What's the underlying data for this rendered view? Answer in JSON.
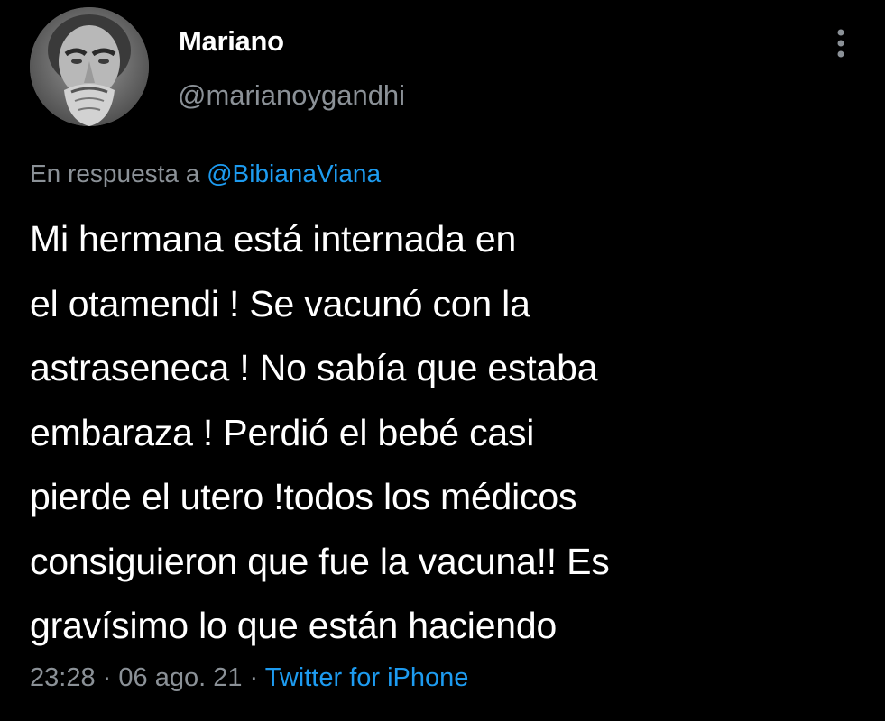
{
  "tweet": {
    "author": {
      "display_name": "Mariano",
      "handle": "@marianoygandhi"
    },
    "reply_to": {
      "prefix": "En respuesta a",
      "mention": "@BibianaViana"
    },
    "text": "Mi hermana está internada en\nel otamendi ! Se vacunó con la\nastraseneca ! No sabía que estaba\nembaraza ! Perdió el bebé casi\npierde el utero !todos los médicos\nconsiguieron que fue la vacuna!! Es\ngravísimo lo que están haciendo",
    "time": "23:28",
    "date": "06 ago. 21",
    "source": "Twitter for iPhone",
    "separator": "·"
  },
  "icons": {
    "more": "more-vertical-icon",
    "avatar": "statue-avatar"
  },
  "colors": {
    "background": "#000000",
    "text": "#ffffff",
    "secondary": "#8b9197",
    "link": "#1d9bf0"
  }
}
